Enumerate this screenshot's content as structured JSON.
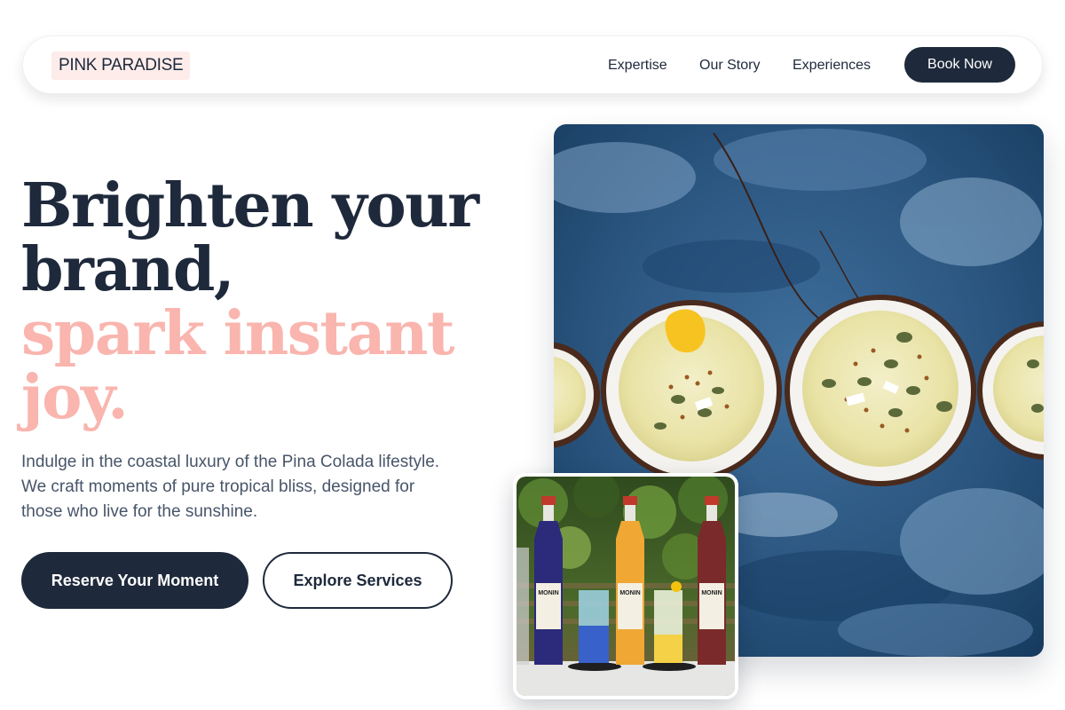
{
  "nav": {
    "logo": "PINK PARADISE",
    "links": [
      "Expertise",
      "Our Story",
      "Experiences"
    ],
    "cta": "Book Now"
  },
  "hero": {
    "headline_dark": [
      "Brighten your",
      "brand,"
    ],
    "headline_accent": [
      "spark instant",
      "joy."
    ],
    "subtext": "Indulge in the coastal luxury of the Pina Colada lifestyle. We craft moments of pure tropical bliss, designed for those who live for the sunshine.",
    "primary_cta": "Reserve Your Moment",
    "secondary_cta": "Explore Services"
  },
  "images": {
    "main": "coconut-bowls-photo",
    "inset": "monin-syrup-bottles-photo",
    "bottle_brand": "MONIN"
  },
  "colors": {
    "navy": "#1e293b",
    "accent_pink": "#f9b5ae",
    "logo_bg": "#fdecea",
    "body_text": "#475569"
  }
}
